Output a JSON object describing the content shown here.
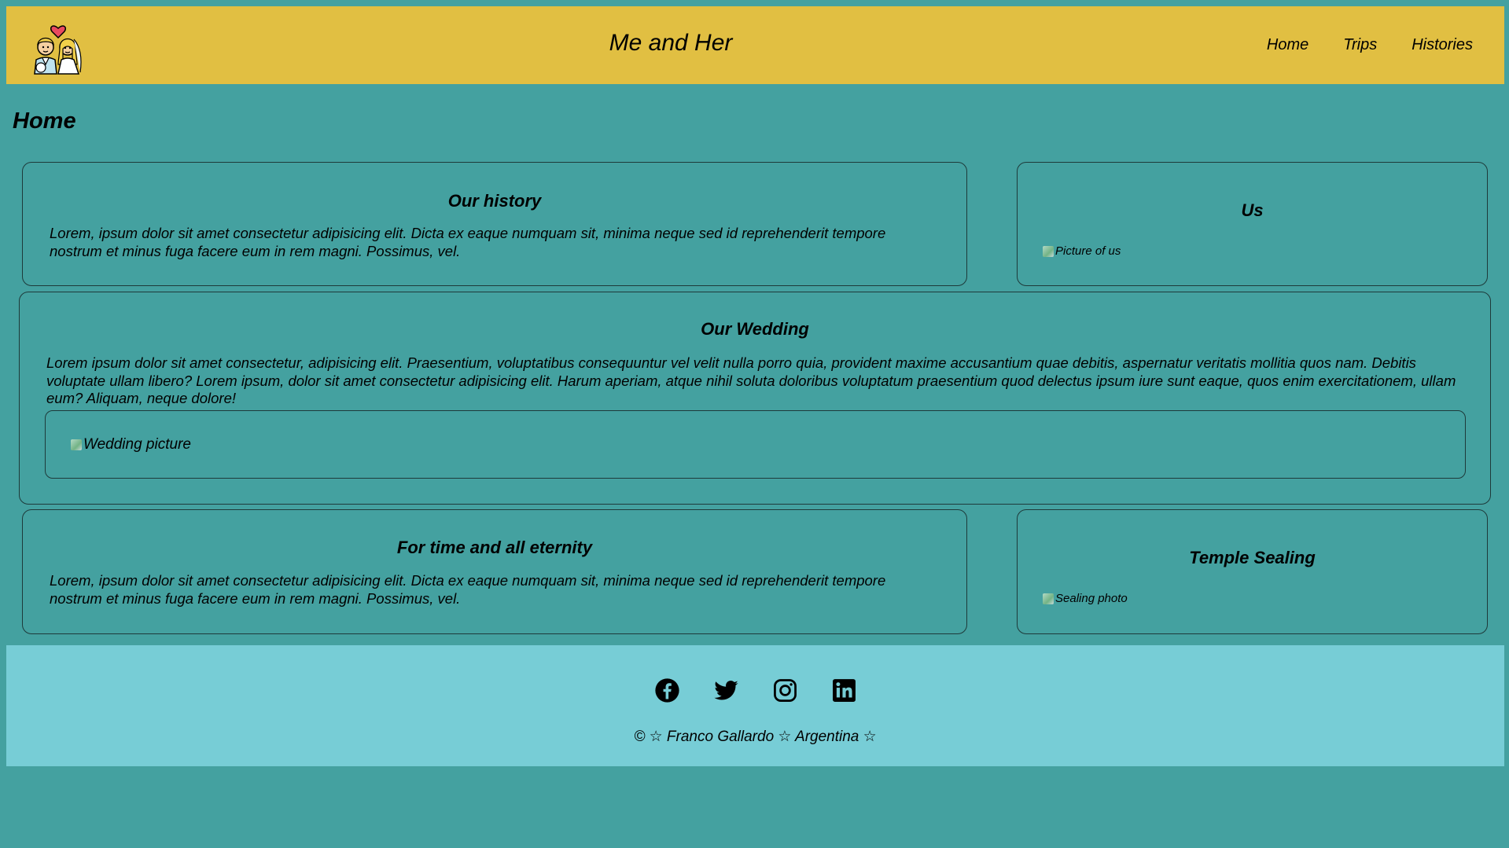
{
  "header": {
    "title": "Me and Her",
    "nav": [
      {
        "label": "Home"
      },
      {
        "label": "Trips"
      },
      {
        "label": "Histories"
      }
    ],
    "logo_icon": "bride-groom-logo-icon"
  },
  "main": {
    "heading": "Home",
    "history": {
      "title": "Our history",
      "text": "Lorem, ipsum dolor sit amet consectetur adipisicing elit. Dicta ex eaque numquam sit, minima neque sed id reprehenderit tempore nostrum et minus fuga facere eum in rem magni. Possimus, vel."
    },
    "us": {
      "title": "Us",
      "img_alt": "Picture of us"
    },
    "wedding": {
      "title": "Our Wedding",
      "text": "Lorem ipsum dolor sit amet consectetur, adipisicing elit. Praesentium, voluptatibus consequuntur vel velit nulla porro quia, provident maxime accusantium quae debitis, aspernatur veritatis mollitia quos nam. Debitis voluptate ullam libero? Lorem ipsum, dolor sit amet consectetur adipisicing elit. Harum aperiam, atque nihil soluta doloribus voluptatum praesentium quod delectus ipsum iure sunt eaque, quos enim exercitationem, ullam eum? Aliquam, neque dolore!",
      "img_alt": "Wedding picture"
    },
    "eternity": {
      "title": "For time and all eternity",
      "text": "Lorem, ipsum dolor sit amet consectetur adipisicing elit. Dicta ex eaque numquam sit, minima neque sed id reprehenderit tempore nostrum et minus fuga facere eum in rem magni. Possimus, vel."
    },
    "sealing": {
      "title": "Temple Sealing",
      "img_alt": "Sealing photo"
    }
  },
  "footer": {
    "socials": [
      "facebook-icon",
      "twitter-icon",
      "instagram-icon",
      "linkedin-icon"
    ],
    "copyright": "©  ☆ Franco Gallardo ☆ Argentina ☆"
  },
  "colors": {
    "background": "#44a1a0",
    "header": "#e1bf42",
    "footer": "#77cdd6"
  }
}
